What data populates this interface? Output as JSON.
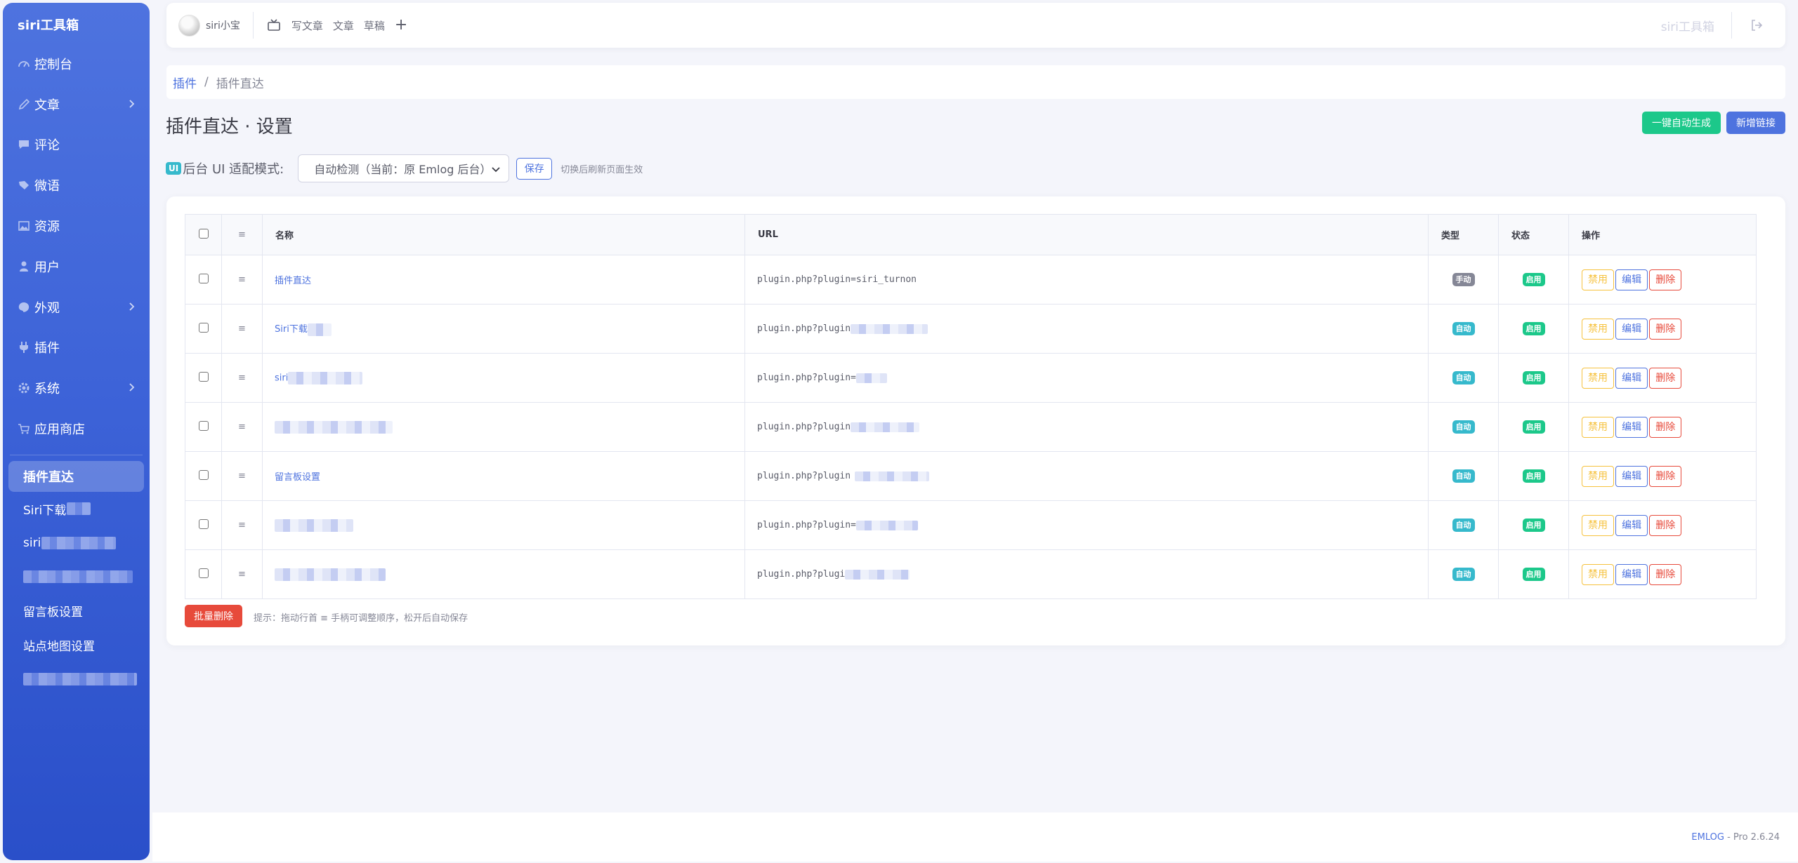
{
  "sidebar": {
    "brand": "siri工具箱",
    "items": [
      {
        "label": "控制台",
        "icon": "dashboard-icon"
      },
      {
        "label": "文章",
        "icon": "pencil-icon",
        "has_children": true
      },
      {
        "label": "评论",
        "icon": "comment-icon"
      },
      {
        "label": "微语",
        "icon": "tag-icon"
      },
      {
        "label": "资源",
        "icon": "image-icon"
      },
      {
        "label": "用户",
        "icon": "user-icon"
      },
      {
        "label": "外观",
        "icon": "palette-icon",
        "has_children": true
      },
      {
        "label": "插件",
        "icon": "plug-icon"
      },
      {
        "label": "系统",
        "icon": "gear-icon",
        "has_children": true
      },
      {
        "label": "应用商店",
        "icon": "cart-icon"
      }
    ],
    "sub_active": "插件直达",
    "sub_items": [
      {
        "label": "Siri下载"
      },
      {
        "label": "siri"
      },
      {
        "label": ""
      },
      {
        "label": "留言板设置"
      },
      {
        "label": "站点地图设置"
      },
      {
        "label": ""
      }
    ]
  },
  "topbar": {
    "username": "siri小宝",
    "links": [
      "写文章",
      "文章",
      "草稿"
    ],
    "plus": "+",
    "brand": "siri工具箱"
  },
  "breadcrumb": {
    "parent": "插件",
    "separator": "/",
    "current": "插件直达"
  },
  "page": {
    "title": "插件直达 · 设置",
    "btn_auto": "一键自动生成",
    "btn_new": "新增链接"
  },
  "ui_mode": {
    "badge": "UI",
    "label": "后台 UI 适配模式:",
    "select_value": "自动检测（当前：原 Emlog 后台）",
    "save": "保存",
    "hint": "切换后刷新页面生效"
  },
  "table": {
    "headers": {
      "handle": "≡",
      "name": "名称",
      "url": "URL",
      "type": "类型",
      "status": "状态",
      "ops": "操作"
    },
    "ops": {
      "disable": "禁用",
      "edit": "编辑",
      "delete": "删除"
    },
    "rows": [
      {
        "name": "插件直达",
        "url": "plugin.php?plugin=siri_turnon",
        "type": "手动",
        "type_kind": "manual",
        "status": "启用"
      },
      {
        "name": "Siri下载",
        "url": "plugin.php?plugin",
        "type": "自动",
        "type_kind": "auto",
        "status": "启用"
      },
      {
        "name": "siri",
        "url": "plugin.php?plugin=",
        "type": "自动",
        "type_kind": "auto",
        "status": "启用"
      },
      {
        "name": "",
        "url": "plugin.php?plugin",
        "type": "自动",
        "type_kind": "auto",
        "status": "启用"
      },
      {
        "name": "留言板设置",
        "url": "plugin.php?plugin",
        "type": "自动",
        "type_kind": "auto",
        "status": "启用"
      },
      {
        "name": "",
        "url": "plugin.php?plugin=",
        "type": "自动",
        "type_kind": "auto",
        "status": "启用"
      },
      {
        "name": "",
        "url": "plugin.php?plugi",
        "type": "自动",
        "type_kind": "auto",
        "status": "启用"
      }
    ]
  },
  "batch_delete": "批量删除",
  "footer_hint": "提示：拖动行首 ≡ 手柄可调整顺序，松开后自动保存",
  "footer": {
    "brand": "EMLOG",
    "version": " - Pro 2.6.24"
  },
  "colors": {
    "primary": "#4e73df",
    "success": "#1cc88a",
    "info": "#36b9cc",
    "warning": "#f6c23e",
    "danger": "#e74a3b",
    "secondary": "#858796"
  }
}
